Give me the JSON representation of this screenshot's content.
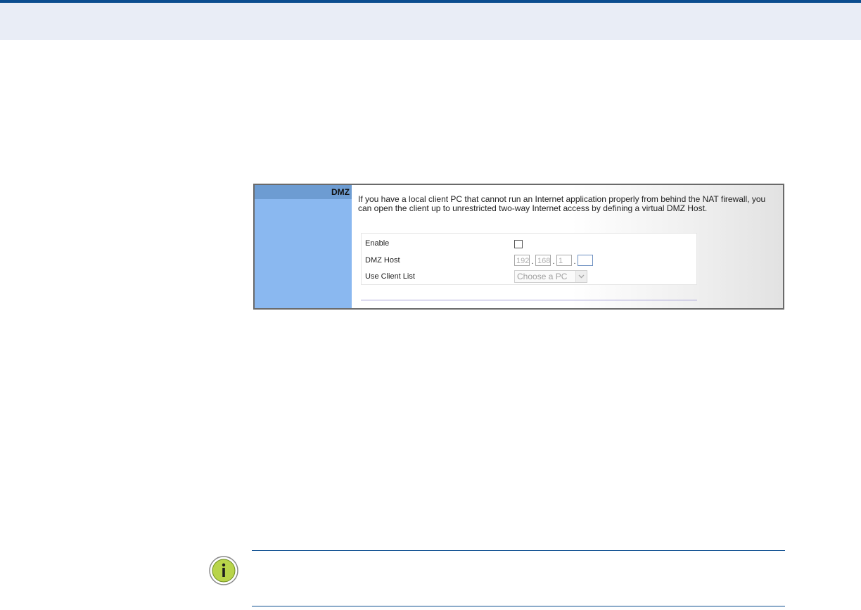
{
  "dmz_panel": {
    "section_title": "DMZ",
    "description": "If you have a local client PC that cannot run an Internet application properly from behind the NAT firewall, you can open the client up to unrestricted two-way Internet access by defining a virtual DMZ Host.",
    "enable_label": "Enable",
    "enable_checked": false,
    "dmz_host_label": "DMZ Host",
    "dmz_host_octets": [
      "192",
      "168",
      "1",
      ""
    ],
    "ip_separator": ".",
    "client_list_label": "Use Client List",
    "client_list_value": "Choose a PC"
  },
  "colors": {
    "header_band": "#e9edf6",
    "header_rule": "#0b4d8f",
    "side_column": "#8ab8f0",
    "side_header": "#6d9cd2",
    "note_icon": "#b8d44a"
  },
  "icons": {
    "note": "info-icon",
    "dropdown": "chevron-down-icon"
  }
}
